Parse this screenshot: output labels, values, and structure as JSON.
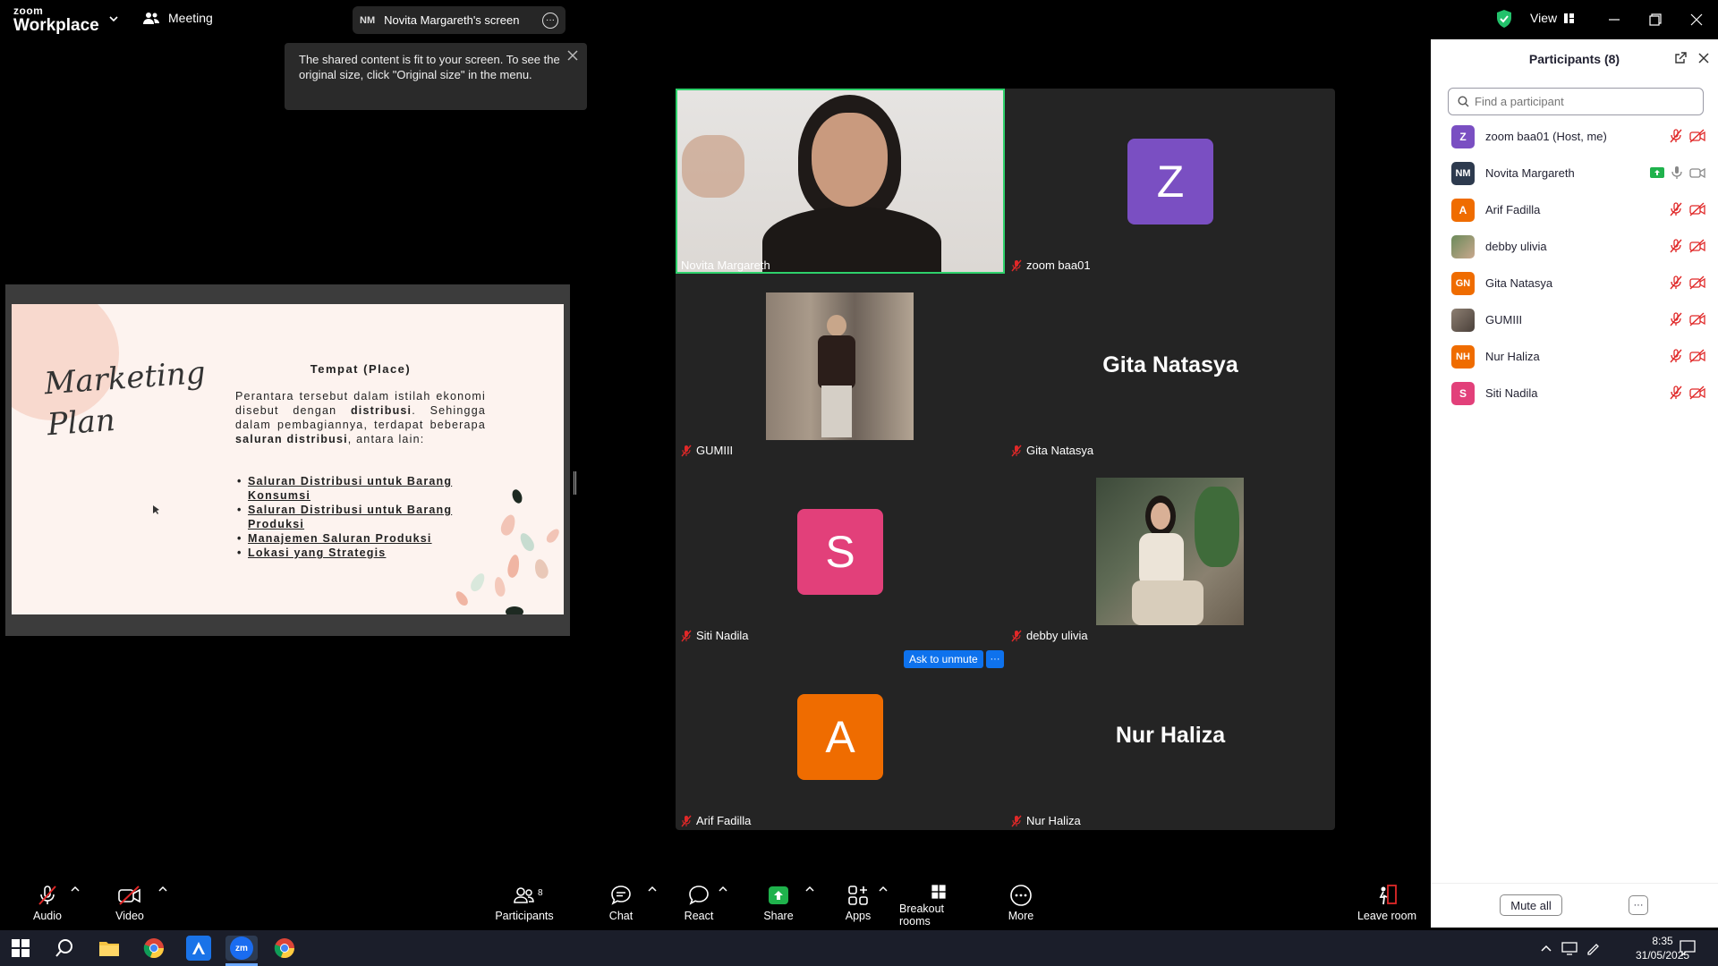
{
  "titlebar": {
    "logo_top": "zoom",
    "logo_bottom": "Workplace",
    "meeting_label": "Meeting",
    "share_initials": "NM",
    "share_label": "Novita Margareth's screen",
    "view_label": "View"
  },
  "tooltip": {
    "text": "The shared content is fit to your screen. To see the original size, click \"Original size\" in the menu."
  },
  "slide": {
    "script_line1": "Marketing",
    "script_line2": "Plan",
    "title": "Tempat (Place)",
    "body_1": "Perantara tersebut dalam istilah ekonomi disebut dengan ",
    "body_bold_1": "distribusi",
    "body_2": ". Sehingga dalam pembagiannya, terdapat beberapa ",
    "body_bold_2": "saluran distribusi",
    "body_3": ", antara lain:",
    "bullets": [
      "Saluran Distribusi untuk Barang Konsumsi",
      "Saluran Distribusi untuk Barang Produksi",
      "Manajemen Saluran Produksi",
      "Lokasi yang Strategis"
    ]
  },
  "grid": {
    "tiles": [
      {
        "name": "Novita Margareth"
      },
      {
        "name": "zoom baa01",
        "initial": "Z",
        "color": "#7a4fc2"
      },
      {
        "name": "GUMIII"
      },
      {
        "name": "Gita Natasya",
        "bigname": "Gita Natasya"
      },
      {
        "name": "Siti Nadila",
        "initial": "S",
        "color": "#e2407a"
      },
      {
        "name": "debby ulivia"
      },
      {
        "name": "Arif Fadilla",
        "initial": "A",
        "color": "#ef6c00"
      },
      {
        "name": "Nur Haliza",
        "bigname": "Nur Haliza"
      }
    ],
    "ask_unmute": "Ask to unmute",
    "ask_more": "···"
  },
  "panel": {
    "title": "Participants (8)",
    "search_placeholder": "Find a participant",
    "participants": [
      {
        "name": "zoom baa01 (Host, me)",
        "initials": "Z",
        "color": "#7a4fc2"
      },
      {
        "name": "Novita Margareth",
        "initials": "NM",
        "color": "#2d3a4e"
      },
      {
        "name": "Arif Fadilla",
        "initials": "A",
        "color": "#ef6c00"
      },
      {
        "name": "debby ulivia",
        "initials": "",
        "color": "#b9a58f"
      },
      {
        "name": "Gita Natasya",
        "initials": "GN",
        "color": "#ef6c00"
      },
      {
        "name": "GUMIII",
        "initials": "",
        "color": "#6f655b"
      },
      {
        "name": "Nur Haliza",
        "initials": "NH",
        "color": "#ef6c00"
      },
      {
        "name": "Siti Nadila",
        "initials": "S",
        "color": "#e2407a"
      }
    ],
    "mute_all": "Mute all",
    "more": "···"
  },
  "toolbar": {
    "audio": "Audio",
    "video": "Video",
    "participants": "Participants",
    "participants_count": "8",
    "chat": "Chat",
    "react": "React",
    "share": "Share",
    "apps": "Apps",
    "breakout": "Breakout rooms",
    "more": "More",
    "leave": "Leave room"
  },
  "taskbar": {
    "time": "8:35",
    "date": "31/05/2025",
    "zoom_label": "zm"
  }
}
